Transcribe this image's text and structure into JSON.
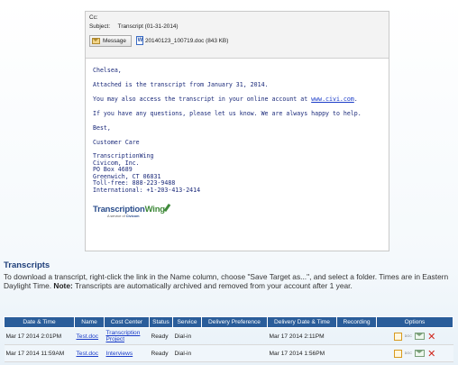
{
  "email": {
    "cc_label": "Cc:",
    "subject_label": "Subject:",
    "subject_value": "Transcript (01-31-2014)",
    "message_tab": "Message",
    "attachment": "20140123_100719.doc (843 KB)",
    "greeting": "Chelsea,",
    "line1": "Attached is the transcript from January 31, 2014.",
    "line2_prefix": "You may also access the transcript in your online account at ",
    "line2_link": "www.civi.com",
    "line2_suffix": ".",
    "line3": "If you have any questions, please let us know. We are always happy to help.",
    "closing": "Best,",
    "signoff": "Customer Care",
    "signature": [
      "TranscriptionWing",
      "Civicom, Inc.",
      "PO Box 4689",
      "Greenwich, CT 06831",
      "Toll-free: 888-223-9488",
      "International: +1-203-413-2414"
    ],
    "logo_text_a": "Transcription",
    "logo_text_b": "Wing",
    "logo_sub": "A service of",
    "logo_sub_brand": "Civicom"
  },
  "transcripts": {
    "title": "Transcripts",
    "desc_main": "To download a transcript, right-click the link in the Name column, choose \"Save Target as...\", and select a folder. Times are in Eastern Daylight Time. ",
    "desc_note_label": "Note:",
    "desc_note": " Transcripts are automatically archived and removed from your account after 1 year.",
    "columns": [
      "Date & Time",
      "Name",
      "Cost Center",
      "Status",
      "Service",
      "Delivery Preference",
      "Delivery Date & Time",
      "Recording",
      "Options"
    ],
    "rows": [
      {
        "date": "Mar 17 2014 2:01PM",
        "name": "Test.doc",
        "cost_center": "Transcription Project",
        "status": "Ready",
        "service": "Dial-in",
        "pref": "",
        "delivery": "Mar 17 2014 2:11PM",
        "recording": ""
      },
      {
        "date": "Mar 17 2014 11:59AM",
        "name": "Test.doc",
        "cost_center": "Interviews",
        "status": "Ready",
        "service": "Dial-in",
        "pref": "",
        "delivery": "Mar 17 2014 1:56PM",
        "recording": ""
      }
    ],
    "option_doc_label": "DOC"
  }
}
